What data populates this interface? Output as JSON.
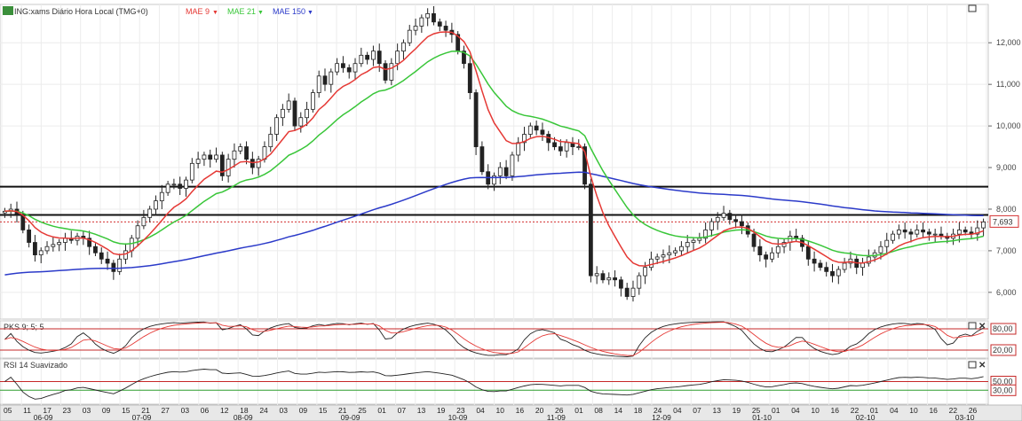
{
  "chart_data": {
    "type": "candlestick",
    "title": "ING:xams Diário Hora Local (TMG+0)",
    "indicators": [
      {
        "name": "MAE 9",
        "color": "#e53935"
      },
      {
        "name": "MAE 21",
        "color": "#39c639"
      },
      {
        "name": "MAE 150",
        "color": "#2b3ac9"
      }
    ],
    "price_axis": {
      "range": [
        5400,
        12900
      ],
      "ticks": [
        "12,000",
        "11,000",
        "10,000",
        "9,000",
        "8,000",
        "7,000",
        "6,000"
      ],
      "tick_values": [
        12000,
        11000,
        10000,
        9000,
        8000,
        7000,
        6000
      ]
    },
    "last_price_label": "7,693",
    "horizontal_lines": [
      8540,
      7860
    ],
    "dotted_line": 7693,
    "closes": [
      7950,
      8000,
      7880,
      7500,
      7200,
      6900,
      7000,
      7100,
      7150,
      7200,
      7300,
      7250,
      7350,
      7300,
      7100,
      6950,
      6800,
      6700,
      6500,
      6800,
      7000,
      7300,
      7600,
      7800,
      8000,
      8200,
      8400,
      8600,
      8600,
      8500,
      8700,
      9100,
      9200,
      9300,
      9200,
      9300,
      8800,
      9200,
      9400,
      9500,
      9200,
      9000,
      9200,
      9500,
      9800,
      10200,
      10400,
      10600,
      10000,
      10200,
      10400,
      10800,
      11200,
      11000,
      11300,
      11500,
      11400,
      11300,
      11500,
      11700,
      11600,
      11800,
      11500,
      11100,
      11500,
      11800,
      12000,
      12300,
      12400,
      12600,
      12700,
      12500,
      12400,
      12300,
      12200,
      11800,
      11500,
      10800,
      9500,
      8900,
      8600,
      8800,
      9000,
      8800,
      9300,
      9600,
      9800,
      10000,
      9900,
      9800,
      9600,
      9500,
      9400,
      9600,
      9500,
      9500,
      8600,
      6400,
      6450,
      6300,
      6350,
      6300,
      6100,
      5900,
      6100,
      6400,
      6600,
      6800,
      6850,
      6900,
      6950,
      7000,
      7100,
      7200,
      7250,
      7300,
      7500,
      7700,
      7800,
      7900,
      7750,
      7700,
      7600,
      7400,
      7100,
      6900,
      6800,
      6950,
      7100,
      7200,
      7350,
      7300,
      7100,
      6800,
      6700,
      6600,
      6500,
      6400,
      6550,
      6700,
      6800,
      6600,
      6700,
      6850,
      6950,
      7100,
      7250,
      7400,
      7500,
      7450,
      7400,
      7500,
      7450,
      7400,
      7400,
      7350,
      7300,
      7400,
      7500,
      7450,
      7400,
      7550,
      7693
    ],
    "sub_panels": [
      {
        "title": "PKS 9; 5; 5",
        "levels": [
          "80,00",
          "20,00"
        ],
        "level_values": [
          80,
          20
        ],
        "range": [
          0,
          100
        ]
      },
      {
        "title": "RSI 14 Suavizado",
        "levels": [
          "50,00",
          "30,00"
        ],
        "level_values": [
          50,
          30
        ],
        "range": [
          0,
          100
        ]
      }
    ],
    "x_day_labels": [
      "05",
      "11",
      "17",
      "23",
      "03",
      "09",
      "15",
      "21",
      "27",
      "03",
      "06",
      "12",
      "18",
      "24",
      "03",
      "09",
      "15",
      "21",
      "25",
      "01",
      "07",
      "13",
      "19",
      "23",
      "04",
      "10",
      "16",
      "20",
      "26",
      "01",
      "08",
      "14",
      "18",
      "24",
      "04",
      "07",
      "13",
      "19",
      "25",
      "01",
      "04",
      "10",
      "16",
      "22",
      "01",
      "04",
      "10",
      "16",
      "22",
      "26"
    ],
    "x_month_labels": [
      "06-09",
      "07-09",
      "08-09",
      "09-09",
      "10-09",
      "11-09",
      "12-09",
      "01-10",
      "02-10",
      "03-10"
    ],
    "x_label_interval": 3.36,
    "x_month_positions": [
      4.2,
      14.2,
      24.5,
      35.4,
      46.3,
      56.3,
      67.0,
      77.2,
      87.7,
      97.8
    ]
  },
  "colors": {
    "up": "#2b8c2b",
    "down": "#222222",
    "ma_fast": "#e53935",
    "ma_mid": "#39c639",
    "ma_slow": "#2b3ac9",
    "level": "#c62828"
  }
}
